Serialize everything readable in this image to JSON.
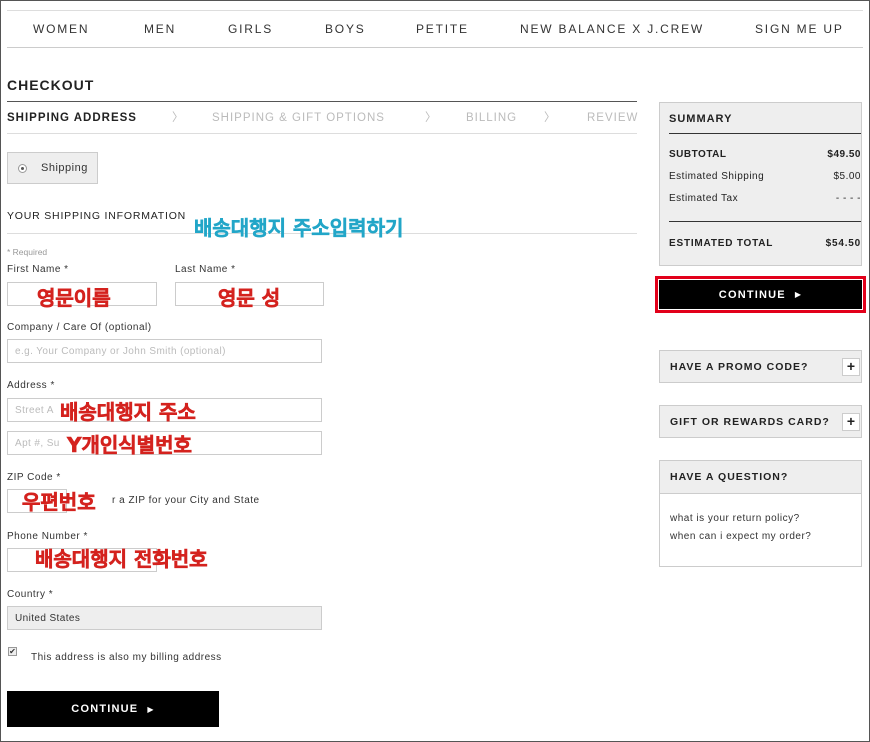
{
  "nav": {
    "items": [
      "WOMEN",
      "MEN",
      "GIRLS",
      "BOYS",
      "PETITE",
      "NEW BALANCE X J.CREW",
      "SIGN ME UP"
    ]
  },
  "checkout": {
    "title": "CHECKOUT",
    "steps": [
      {
        "label": "SHIPPING ADDRESS",
        "active": true
      },
      {
        "label": "SHIPPING & GIFT OPTIONS",
        "active": false
      },
      {
        "label": "BILLING",
        "active": false
      },
      {
        "label": "REVIEW",
        "active": false
      }
    ],
    "step_separator_icon": "chevron-right-icon",
    "shipping_toggle_label": "Shipping",
    "section_title": "YOUR SHIPPING INFORMATION",
    "required_note": "* Required"
  },
  "form": {
    "first_name": {
      "label": "First Name *",
      "value": ""
    },
    "last_name": {
      "label": "Last Name *",
      "value": ""
    },
    "company": {
      "label": "Company / Care Of (optional)",
      "placeholder": "e.g. Your Company or John Smith (optional)"
    },
    "address": {
      "label": "Address *",
      "street_placeholder": "Street A",
      "apt_placeholder": "Apt #, Su"
    },
    "zip": {
      "label": "ZIP Code *",
      "hint": "r a ZIP for your City and State"
    },
    "phone": {
      "label": "Phone Number *"
    },
    "country": {
      "label": "Country *",
      "value": "United States"
    },
    "billing_same": {
      "label": "This address is also my billing address",
      "checked": true
    },
    "continue_label": "CONTINUE"
  },
  "annotations": {
    "shipping_address_entry": "배송대행지 주소입력하기",
    "first_name": "영문이름",
    "last_name": "영문 성",
    "address": "배송대행지 주소",
    "personal_id": "Y개인식별번호",
    "zip": "우편번호",
    "phone": "배송대행지 전화번호"
  },
  "summary": {
    "title": "SUMMARY",
    "subtotal_label": "SUBTOTAL",
    "subtotal_value": "$49.50",
    "shipping_label": "Estimated Shipping",
    "shipping_value": "$5.00",
    "tax_label": "Estimated Tax",
    "tax_value": "- - - -",
    "total_label": "ESTIMATED TOTAL",
    "total_value": "$54.50",
    "continue_label": "CONTINUE"
  },
  "sidebar": {
    "promo_label": "HAVE A PROMO CODE?",
    "gift_label": "GIFT OR REWARDS CARD?",
    "question_label": "HAVE A QUESTION?",
    "questions": [
      "what is your return policy?",
      "when can i expect my order?"
    ],
    "expand_icon": "plus-icon"
  },
  "colors": {
    "annotation_red": "#d4221e",
    "annotation_blue": "#22a6c8",
    "highlight_outline": "#e2001a",
    "button_bg": "#000000"
  }
}
